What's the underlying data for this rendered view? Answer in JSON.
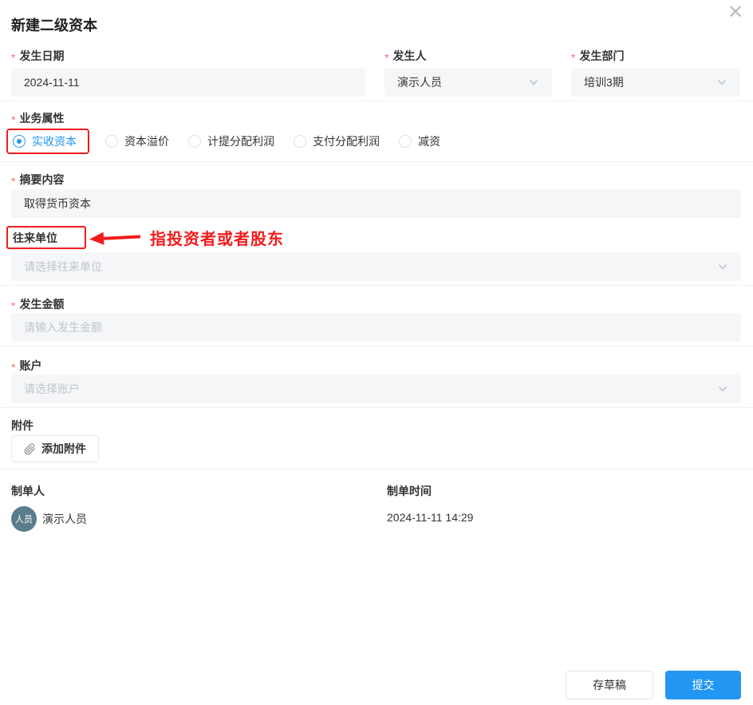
{
  "dialog": {
    "title": "新建二级资本"
  },
  "icons": {
    "close": "✕",
    "chevron_down": "chevron-down-icon",
    "paperclip": "paperclip-icon"
  },
  "colors": {
    "primary_blue": "#2196f3",
    "annotation_red": "#f21c1c",
    "required_red": "#f56c6c",
    "avatar_bg": "#5a7d8c",
    "input_bg": "#f5f6f7"
  },
  "required_mark": "*",
  "form": {
    "occur_date": {
      "label": "发生日期",
      "value": "2024-11-11"
    },
    "occur_person": {
      "label": "发生人",
      "value": "演示人员"
    },
    "occur_dept": {
      "label": "发生部门",
      "value": "培训3期"
    },
    "business_attr": {
      "label": "业务属性",
      "selected": "实收资本",
      "options": [
        "实收资本",
        "资本溢价",
        "计提分配利润",
        "支付分配利润",
        "减资"
      ]
    },
    "summary": {
      "label": "摘要内容",
      "value": "取得货币资本"
    },
    "counterparty": {
      "label": "往来单位",
      "placeholder": "请选择往来单位"
    },
    "amount": {
      "label": "发生金额",
      "placeholder": "请输入发生金额"
    },
    "account": {
      "label": "账户",
      "placeholder": "请选择账户"
    },
    "attachment": {
      "label": "附件",
      "add_button": "添加附件"
    }
  },
  "annotation": {
    "text": "指投资者或者股东"
  },
  "meta": {
    "creator_label": "制单人",
    "creator_avatar": "人员",
    "creator_name": "演示人员",
    "time_label": "制单时间",
    "time_value": "2024-11-11 14:29"
  },
  "footer": {
    "save_draft": "存草稿",
    "submit": "提交"
  }
}
